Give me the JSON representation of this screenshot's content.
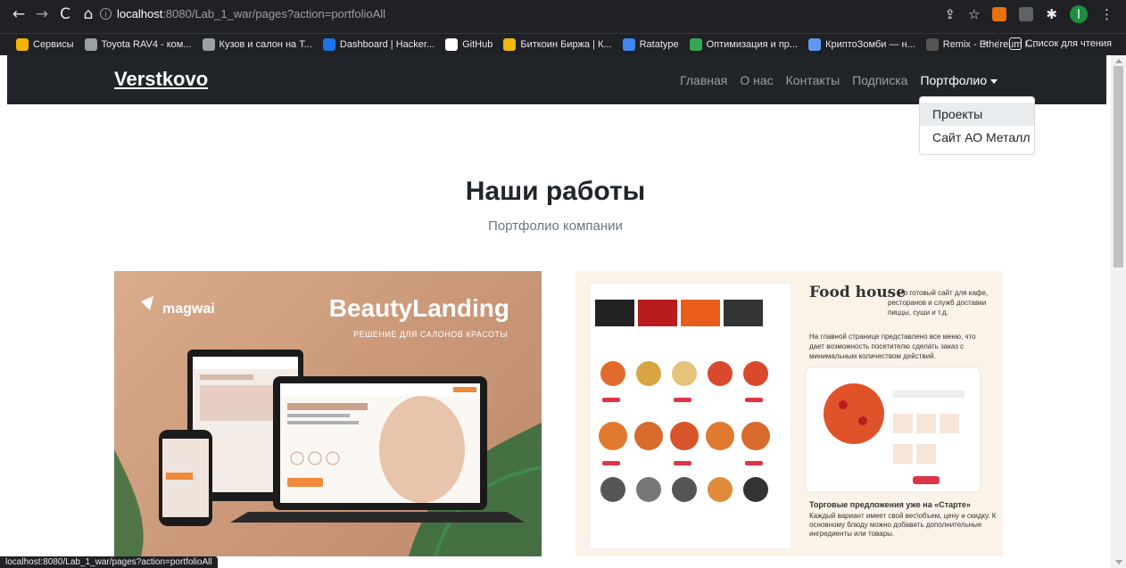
{
  "browser": {
    "url_host": "localhost",
    "url_path": ":8080/Lab_1_war/pages?action=portfolioAll",
    "nav": {
      "back": "←",
      "forward": "→",
      "reload": "C",
      "home": "⌂"
    },
    "status_url": "localhost:8080/Lab_1_war/pages?action=portfolioAll",
    "profile_letter": "I"
  },
  "bookmarks": [
    {
      "label": "Сервисы",
      "icon_color": "#f4b400"
    },
    {
      "label": "Toyota RAV4 - ком...",
      "icon_color": "#9aa0a6"
    },
    {
      "label": "Кузов и салон на Т...",
      "icon_color": "#9aa0a6"
    },
    {
      "label": "Dashboard | Hacker...",
      "icon_color": "#1a73e8"
    },
    {
      "label": "GitHub",
      "icon_color": "#ffffff"
    },
    {
      "label": "Биткоин Биржа | К...",
      "icon_color": "#f0b90b"
    },
    {
      "label": "Ratatype",
      "icon_color": "#4285f4"
    },
    {
      "label": "Оптимизация и пр...",
      "icon_color": "#34a853"
    },
    {
      "label": "КриптоЗомби — н...",
      "icon_color": "#5e97f6"
    },
    {
      "label": "Remix - Ethereum I...",
      "icon_color": "#555555"
    }
  ],
  "bookmarks_overflow": "»",
  "reading_list": "Список для чтения",
  "site": {
    "brand": "Verstkovo",
    "nav": [
      {
        "label": "Главная"
      },
      {
        "label": "О нас"
      },
      {
        "label": "Контакты"
      },
      {
        "label": "Подписка"
      },
      {
        "label": "Портфолио"
      }
    ],
    "dropdown": [
      {
        "label": "Проекты"
      },
      {
        "label": "Сайт АО Металл"
      }
    ]
  },
  "main": {
    "title": "Наши работы",
    "subtitle": "Портфолио компании"
  },
  "cards": {
    "beauty": {
      "logo": "magwai",
      "title": "BeautyLanding",
      "subtitle": "РЕШЕНИЕ ДЛЯ САЛОНОВ КРАСОТЫ",
      "bg_color": "#d1a083"
    },
    "food": {
      "title": "Food house",
      "text1": "— это готовый сайт для кафе, ресторанов и служб доставки пиццы, суши и т.д.",
      "text2": "На главной странице представлено все меню, что дает возможность посетителю сделать заказ с минимальным количеством действий.",
      "bottom_title": "Торговые предложения уже на «Старте»",
      "bottom_text": "Каждый вариант имеет свой вес\\объем, цену и скидку. К основному блюду можно добавить дополнительные ингредиенты или товары.",
      "bg_color": "#fbf3e7"
    }
  }
}
